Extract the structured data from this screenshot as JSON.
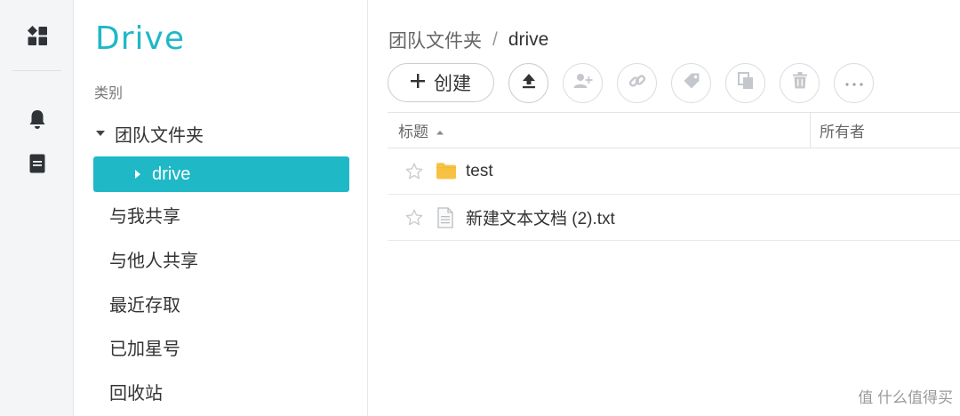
{
  "rail": {
    "icons": [
      "dashboard-icon",
      "bell-icon",
      "document-icon"
    ]
  },
  "sidebar": {
    "logo_text": "Drive",
    "category_label": "类别",
    "items": [
      {
        "label": "团队文件夹",
        "expanded": true
      },
      {
        "label": "drive",
        "active": true
      },
      {
        "label": "与我共享"
      },
      {
        "label": "与他人共享"
      },
      {
        "label": "最近存取"
      },
      {
        "label": "已加星号"
      },
      {
        "label": "回收站"
      }
    ]
  },
  "main": {
    "breadcrumb": {
      "parent": "团队文件夹",
      "separator": "/",
      "current": "drive"
    },
    "toolbar": {
      "create_label": "创建",
      "buttons": [
        "upload-icon",
        "add-user-icon",
        "link-icon",
        "tag-icon",
        "copy-icon",
        "trash-icon",
        "more-icon"
      ]
    },
    "table": {
      "columns": {
        "title": "标题",
        "owner": "所有者"
      },
      "rows": [
        {
          "name": "test",
          "type": "folder"
        },
        {
          "name": "新建文本文档 (2).txt",
          "type": "file"
        }
      ]
    }
  },
  "watermark": "值 什么值得买",
  "colors": {
    "accent": "#1fb8c6",
    "folder": "#f7c244"
  }
}
